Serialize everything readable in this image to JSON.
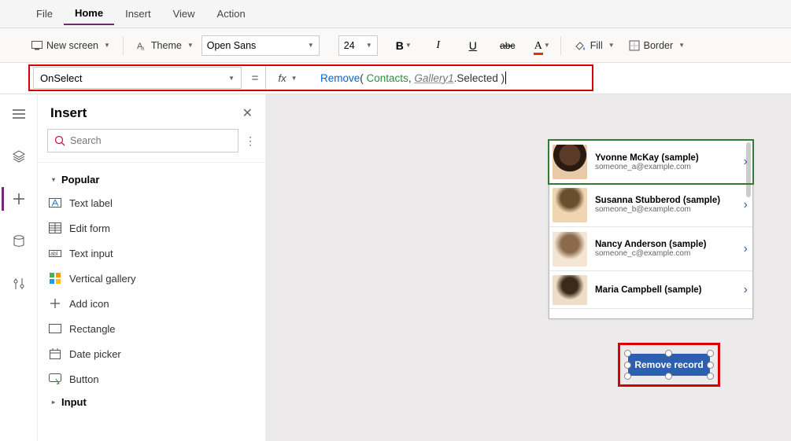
{
  "menu": {
    "file": "File",
    "home": "Home",
    "insert": "Insert",
    "view": "View",
    "action": "Action"
  },
  "toolbar": {
    "new_screen": "New screen",
    "theme": "Theme",
    "font": "Open Sans",
    "size": "24",
    "fill": "Fill",
    "border": "Border"
  },
  "formula": {
    "property": "OnSelect",
    "fn": "Remove",
    "arg1": "Contacts",
    "arg2_obj": "Gallery1",
    "arg2_prop": ".Selected"
  },
  "insert_panel": {
    "title": "Insert",
    "search_placeholder": "Search",
    "popular": "Popular",
    "input": "Input",
    "items": [
      "Text label",
      "Edit form",
      "Text input",
      "Vertical gallery",
      "Add icon",
      "Rectangle",
      "Date picker",
      "Button"
    ]
  },
  "gallery": [
    {
      "name": "Yvonne McKay (sample)",
      "email": "someone_a@example.com"
    },
    {
      "name": "Susanna Stubberod (sample)",
      "email": "someone_b@example.com"
    },
    {
      "name": "Nancy Anderson (sample)",
      "email": "someone_c@example.com"
    },
    {
      "name": "Maria Campbell (sample)",
      "email": ""
    }
  ],
  "button_label": "Remove record"
}
